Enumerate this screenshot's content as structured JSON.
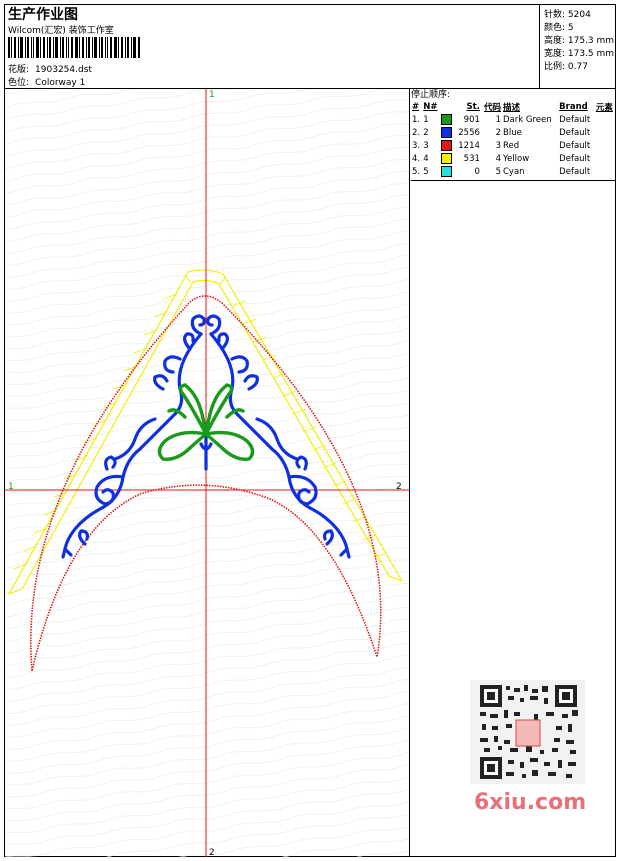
{
  "header": {
    "title": "生产作业图",
    "studio": "Wilcom(汇宏) 装饰工作室",
    "design_label": "花版:",
    "design_value": "1903254.dst",
    "colorway_label": "色位:",
    "colorway_value": "Colorway 1"
  },
  "info": {
    "stitches": "针数: 5204",
    "colors": "颜色: 5",
    "height": "高度: 175.3 mm",
    "width": "宽度: 173.5 mm",
    "scale": "比例: 0.77"
  },
  "stop_sequence": {
    "title": "停止顺序:",
    "headers": [
      "#",
      "N#",
      "St.",
      "代码",
      "描述",
      "Brand",
      "元素"
    ],
    "rows": [
      {
        "n": "1.",
        "nn": "1",
        "color": "#1a9a1a",
        "st": "901",
        "code": "1",
        "desc": "Dark Green",
        "brand": "Default"
      },
      {
        "n": "2.",
        "nn": "2",
        "color": "#1030e0",
        "st": "2556",
        "code": "2",
        "desc": "Blue",
        "brand": "Default"
      },
      {
        "n": "3.",
        "nn": "3",
        "color": "#e01818",
        "st": "1214",
        "code": "3",
        "desc": "Red",
        "brand": "Default"
      },
      {
        "n": "4.",
        "nn": "4",
        "color": "#f0f000",
        "st": "531",
        "code": "4",
        "desc": "Yellow",
        "brand": "Default"
      },
      {
        "n": "5.",
        "nn": "5",
        "color": "#20e0e0",
        "st": "0",
        "code": "5",
        "desc": "Cyan",
        "brand": "Default"
      }
    ]
  },
  "axes": {
    "top": "1",
    "bottom": "2",
    "left": "1",
    "right": "2"
  },
  "watermark": "6xiu.com",
  "colors": {
    "axis": "#e01818",
    "green": "#1a9a1a",
    "blue": "#1030e0",
    "red": "#e01818",
    "yellow": "#f0f000"
  }
}
